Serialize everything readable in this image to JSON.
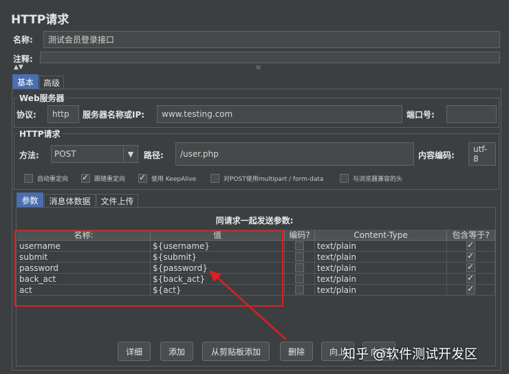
{
  "panel": {
    "title": "HTTP请求"
  },
  "form": {
    "name_label": "名称:",
    "name_value": "测试会员登录接口",
    "comment_label": "注释:"
  },
  "tabs": [
    {
      "label": "基本",
      "active": true
    },
    {
      "label": "高级",
      "active": false
    }
  ],
  "web_server": {
    "title": "Web服务器",
    "protocol_label": "协议:",
    "protocol_value": "http",
    "server_label": "服务器名称或IP:",
    "server_value": "www.testing.com",
    "port_label": "端口号:",
    "port_value": ""
  },
  "http_request": {
    "title": "HTTP请求",
    "method_label": "方法:",
    "method_value": "POST",
    "path_label": "路径:",
    "path_value": "/user.php",
    "encoding_label": "内容编码:",
    "encoding_value": "utf-8",
    "options": [
      {
        "label": "自动重定向",
        "checked": false
      },
      {
        "label": "跟随重定向",
        "checked": true
      },
      {
        "label": "使用 KeepAlive",
        "checked": true
      },
      {
        "label": "对POST使用multipart / form-data",
        "checked": false
      },
      {
        "label": "与浏览器兼容的头",
        "checked": false
      }
    ]
  },
  "sub_tabs": [
    {
      "label": "参数",
      "active": true
    },
    {
      "label": "消息体数据",
      "active": false
    },
    {
      "label": "文件上传",
      "active": false
    }
  ],
  "params": {
    "caption": "同请求一起发送参数:",
    "headers": [
      "名称:",
      "值",
      "编码?",
      "Content-Type",
      "包含等于?"
    ],
    "rows": [
      {
        "name": "username",
        "value": "${username}",
        "encode": false,
        "content_type": "text/plain",
        "include_equals": true
      },
      {
        "name": "submit",
        "value": "${submit}",
        "encode": false,
        "content_type": "text/plain",
        "include_equals": true
      },
      {
        "name": "password",
        "value": "${password}",
        "encode": false,
        "content_type": "text/plain",
        "include_equals": true
      },
      {
        "name": "back_act",
        "value": "${back_act}",
        "encode": false,
        "content_type": "text/plain",
        "include_equals": true
      },
      {
        "name": "act",
        "value": "${act}",
        "encode": false,
        "content_type": "text/plain",
        "include_equals": true
      }
    ]
  },
  "buttons": [
    "详细",
    "添加",
    "从剪贴板添加",
    "删除",
    "向上",
    "向下"
  ],
  "watermark": "知乎 @软件测试开发区",
  "colors": {
    "annotation": "#e02020",
    "accent": "#4b6eaf"
  }
}
